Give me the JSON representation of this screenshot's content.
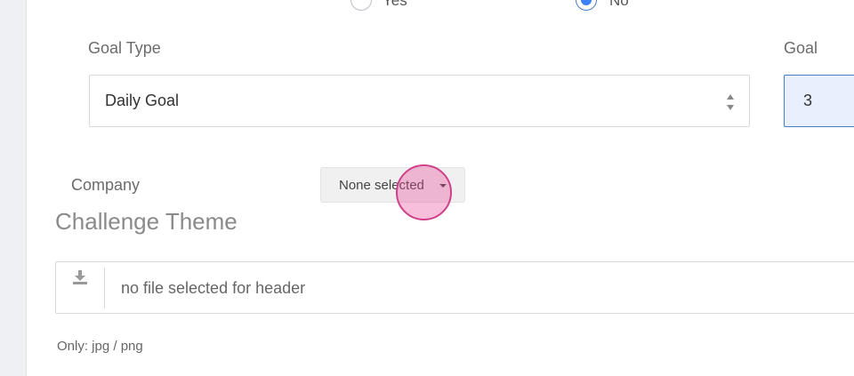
{
  "radios": {
    "yes_label": "Yes",
    "no_label": "No",
    "selected": "No"
  },
  "goal_type": {
    "label": "Goal Type",
    "value": "Daily Goal"
  },
  "goal": {
    "label": "Goal",
    "value": "3"
  },
  "company": {
    "label": "Company",
    "dropdown_text": "None selected"
  },
  "challenge_theme": {
    "title": "Challenge Theme",
    "file_placeholder": "no file selected for header",
    "hint": "Only: jpg / png"
  },
  "icons": {
    "upload": "upload-icon",
    "select_arrows": "sort-arrows-icon",
    "caret": "caret-down-icon"
  },
  "colors": {
    "accent": "#3b82f6",
    "goal_input_bg": "#e8f0fd",
    "cursor_highlight": "#ec4899"
  }
}
